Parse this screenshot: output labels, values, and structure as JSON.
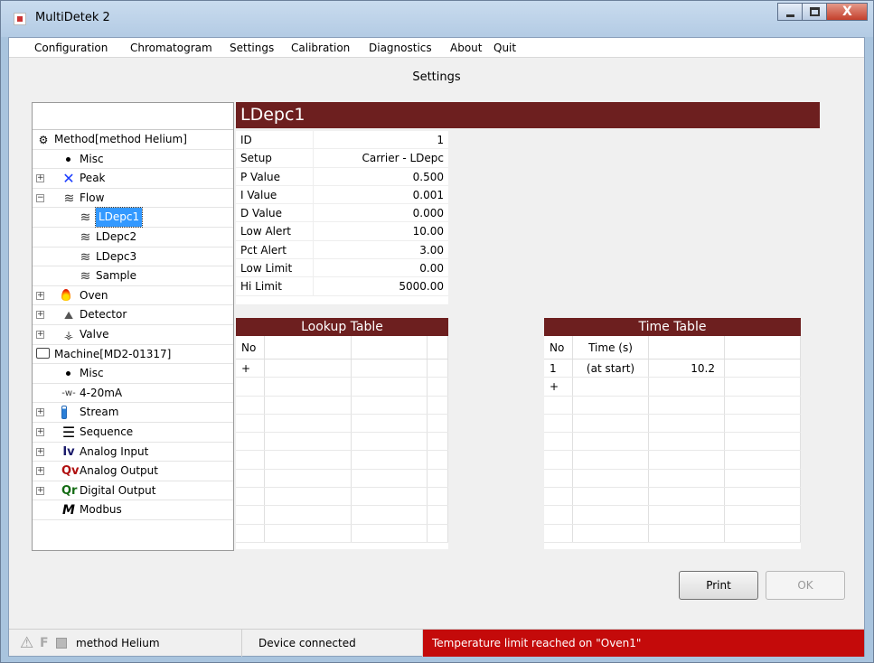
{
  "window": {
    "title": "MultiDetek 2",
    "close_glyph": "X"
  },
  "menu": [
    "Configuration",
    "Chromatogram",
    "Settings",
    "Calibration",
    "Diagnostics",
    "About",
    "Quit"
  ],
  "page_title": "Settings",
  "tree": {
    "items": [
      {
        "label": "Method[method  Helium]",
        "icon": "gear-icon",
        "glyph": "⚙",
        "expander": ""
      },
      {
        "label": "Misc",
        "icon": "bullet-icon",
        "glyph": "",
        "expander": ""
      },
      {
        "label": "Peak",
        "icon": "peak-icon",
        "glyph": "✕",
        "expander": "+"
      },
      {
        "label": "Flow",
        "icon": "flow-icon",
        "glyph": "≋",
        "expander": "−"
      },
      {
        "label": "LDepc1",
        "icon": "flow-icon",
        "glyph": "≋",
        "expander": ""
      },
      {
        "label": "LDepc2",
        "icon": "flow-icon",
        "glyph": "≋",
        "expander": ""
      },
      {
        "label": "LDepc3",
        "icon": "flow-icon",
        "glyph": "≋",
        "expander": ""
      },
      {
        "label": "Sample",
        "icon": "flow-icon",
        "glyph": "≋",
        "expander": ""
      },
      {
        "label": "Oven",
        "icon": "flame-icon",
        "glyph": "",
        "expander": "+"
      },
      {
        "label": "Detector",
        "icon": "detector-icon",
        "glyph": "⛰",
        "expander": "+"
      },
      {
        "label": "Valve",
        "icon": "valve-icon",
        "glyph": "⚶",
        "expander": "+"
      },
      {
        "label": "Machine[MD2-01317]",
        "icon": "machine-icon",
        "glyph": "",
        "expander": ""
      },
      {
        "label": "Misc",
        "icon": "bullet-icon",
        "glyph": "",
        "expander": ""
      },
      {
        "label": "4-20mA",
        "icon": "signal-icon",
        "glyph": "-w-",
        "expander": ""
      },
      {
        "label": "Stream",
        "icon": "stream-icon",
        "glyph": "",
        "expander": "+"
      },
      {
        "label": "Sequence",
        "icon": "list-icon",
        "glyph": "☰",
        "expander": "+"
      },
      {
        "label": "Analog Input",
        "icon": "analog-input-icon",
        "glyph": "Iv",
        "expander": "+"
      },
      {
        "label": "Analog Output",
        "icon": "analog-output-icon",
        "glyph": "Qv",
        "expander": "+"
      },
      {
        "label": "Digital Output",
        "icon": "digital-output-icon",
        "glyph": "Qr",
        "expander": "+"
      },
      {
        "label": "Modbus",
        "icon": "modbus-icon",
        "glyph": "M",
        "expander": ""
      }
    ]
  },
  "section_title": "LDepc1",
  "properties": [
    {
      "key": "ID",
      "value": "1"
    },
    {
      "key": "Setup",
      "value": "Carrier - LDepc"
    },
    {
      "key": "P Value",
      "value": "0.500"
    },
    {
      "key": "I Value",
      "value": "0.001"
    },
    {
      "key": "D Value",
      "value": "0.000"
    },
    {
      "key": "Low Alert",
      "value": "10.00"
    },
    {
      "key": "Pct Alert",
      "value": "3.00"
    },
    {
      "key": "Low Limit",
      "value": "0.00"
    },
    {
      "key": "Hi Limit",
      "value": "5000.00"
    }
  ],
  "lookup_table": {
    "title": "Lookup Table",
    "headers": [
      "No",
      "",
      "",
      ""
    ],
    "add_row_label": "+"
  },
  "time_table": {
    "title": "Time Table",
    "headers": [
      "No",
      "Time (s)",
      "",
      ""
    ],
    "rows": [
      [
        "1",
        "(at start)",
        "10.2",
        ""
      ]
    ],
    "add_row_label": "+"
  },
  "buttons": {
    "print": "Print",
    "ok": "OK"
  },
  "status": {
    "method": "method  Helium",
    "connection": "Device connected",
    "alarm": "Temperature limit reached on \"Oven1\""
  },
  "colors": {
    "header_bg": "#6d1f1f",
    "alarm_bg": "#c40a0a",
    "selection": "#3399ff"
  }
}
